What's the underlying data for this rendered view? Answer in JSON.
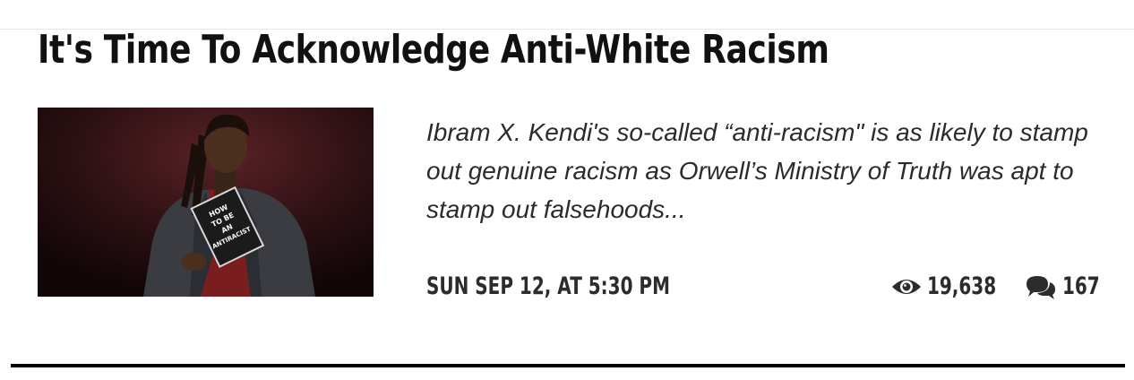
{
  "article": {
    "title": "It's Time To Acknowledge Anti-White Racism",
    "excerpt": "Ibram X. Kendi's so-called “anti-racism\" is as likely to stamp out genuine racism as Orwell’s Ministry of Truth was apt to stamp out falsehoods...",
    "date": "SUN SEP 12, AT 5:30 PM",
    "views": "19,638",
    "comments": "167",
    "view_icon": "eye-icon",
    "comment_icon": "comments-icon",
    "thumbnail": {
      "book_lines": [
        "HOW",
        "TO BE",
        "AN",
        "ANTIRACIST"
      ]
    }
  },
  "colors": {
    "text": "#111111",
    "meta": "#2c2c2c",
    "rule": "#000000",
    "thumbnail_bg": "#2a1113"
  }
}
